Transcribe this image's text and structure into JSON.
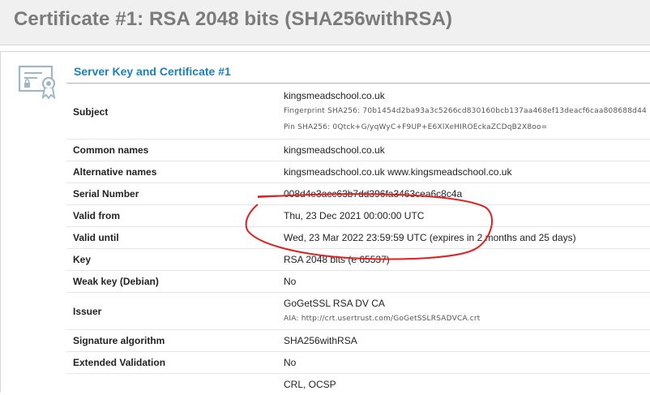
{
  "page_title": "Certificate #1: RSA 2048 bits (SHA256withRSA)",
  "section_title": "Server Key and Certificate #1",
  "icon": "certificate-icon",
  "rows": [
    {
      "label": "Subject",
      "value": "kingsmeadschool.co.uk",
      "fingerprint": "Fingerprint SHA256: 70b1454d2ba93a3c5266cd830160bcb137aa468ef13deacf6caa808688d44",
      "pin": "Pin SHA256: 0Qtck+G/yqWyC+F9UP+E6XlXeHIROEckaZCDqB2X8oo="
    },
    {
      "label": "Common names",
      "value": "kingsmeadschool.co.uk"
    },
    {
      "label": "Alternative names",
      "value": "kingsmeadschool.co.uk www.kingsmeadschool.co.uk"
    },
    {
      "label": "Serial Number",
      "value": "008d4e3acc63b7dd396fa3463cea6c8c4a"
    },
    {
      "label": "Valid from",
      "value": "Thu, 23 Dec 2021 00:00:00 UTC"
    },
    {
      "label": "Valid until",
      "value": "Wed, 23 Mar 2022 23:59:59 UTC (expires in 2 months and 25 days)"
    },
    {
      "label": "Key",
      "value": "RSA 2048 bits (e 65537)"
    },
    {
      "label": "Weak key (Debian)",
      "value": "No"
    },
    {
      "label": "Issuer",
      "value": "GoGetSSL RSA DV CA",
      "aia": "AIA: http://crt.usertrust.com/GoGetSSLRSADVCA.crt"
    },
    {
      "label": "Signature algorithm",
      "value": "SHA256withRSA"
    },
    {
      "label": "Extended Validation",
      "value": "No"
    },
    {
      "label": "",
      "value": "CRL, OCSP"
    }
  ],
  "annotation_color": "#e02020"
}
